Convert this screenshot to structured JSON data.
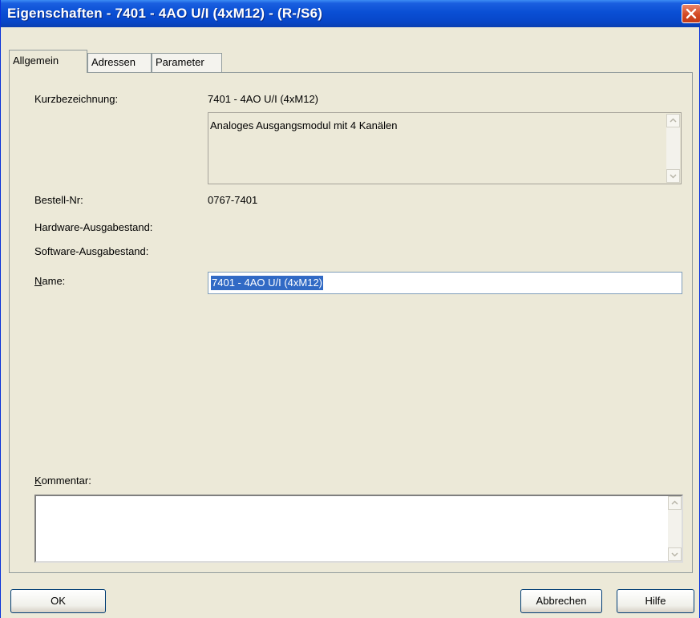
{
  "window": {
    "title": "Eigenschaften - 7401 - 4AO U/I (4xM12) - (R-/S6)"
  },
  "tabs": [
    {
      "label": "Allgemein"
    },
    {
      "label": "Adressen"
    },
    {
      "label": "Parameter"
    }
  ],
  "general": {
    "kurz_label": "Kurzbezeichnung:",
    "kurz_value": "7401 - 4AO U/I (4xM12)",
    "description": "Analoges Ausgangsmodul mit 4 Kanälen",
    "bestell_label": "Bestell-Nr:",
    "bestell_value": "0767-7401",
    "hw_label": "Hardware-Ausgabestand:",
    "sw_label": "Software-Ausgabestand:",
    "name_label_first": "N",
    "name_label_rest": "ame:",
    "name_value": "7401 - 4AO U/I (4xM12)",
    "comment_label_first": "K",
    "comment_label_rest": "ommentar:",
    "comment_value": ""
  },
  "buttons": {
    "ok": "OK",
    "cancel": "Abbrechen",
    "help": "Hilfe"
  },
  "icons": [
    "close-icon",
    "scroll-up-icon",
    "scroll-down-icon"
  ]
}
